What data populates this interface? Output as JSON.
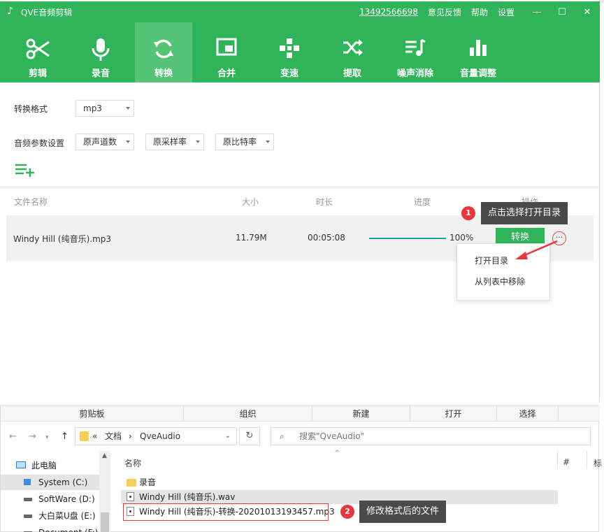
{
  "app": {
    "title": "QVE音频剪辑",
    "phone": "13492566698",
    "links": [
      "意见反馈",
      "帮助",
      "设置"
    ],
    "window_controls": [
      "—",
      "☐",
      "✕"
    ]
  },
  "toolbar": [
    {
      "label": "剪辑",
      "icon": "scissors-icon"
    },
    {
      "label": "录音",
      "icon": "microphone-icon"
    },
    {
      "label": "转换",
      "icon": "convert-icon",
      "active": true
    },
    {
      "label": "合并",
      "icon": "merge-icon"
    },
    {
      "label": "变速",
      "icon": "speed-icon"
    },
    {
      "label": "提取",
      "icon": "extract-icon"
    },
    {
      "label": "噪声消除",
      "icon": "noise-icon"
    },
    {
      "label": "音量调整",
      "icon": "volume-icon"
    }
  ],
  "settings": {
    "format_label": "转换格式",
    "format_value": "mp3",
    "params_label": "音频参数设置",
    "channels": "原声道数",
    "samplerate": "原采样率",
    "bitrate": "原比特率"
  },
  "table": {
    "headers": [
      "文件名称",
      "大小",
      "时长",
      "进度",
      "操作"
    ],
    "row": {
      "name": "Windy Hill (纯音乐).mp3",
      "size": "11.79M",
      "duration": "00:05:08",
      "progress_text": "100%",
      "progress_fraction": 1.0,
      "action": "转换",
      "more": "···"
    }
  },
  "context_menu": [
    "打开目录",
    "从列表中移除"
  ],
  "callouts": [
    {
      "num": "1",
      "text": "点击选择打开目录"
    },
    {
      "num": "2",
      "text": "修改格式后的文件"
    }
  ],
  "explorer": {
    "ribbon": [
      "剪贴板",
      "组织",
      "新建",
      "打开",
      "选择"
    ],
    "path": [
      "«",
      "文档",
      "›",
      "QveAudio"
    ],
    "search_placeholder": "搜索\"QveAudio\"",
    "nav_tree": [
      {
        "label": "此电脑",
        "icon": "computer-icon"
      },
      {
        "label": "System (C:)",
        "icon": "windows-drive-icon",
        "selected": true
      },
      {
        "label": "SoftWare (D:)",
        "icon": "drive-icon"
      },
      {
        "label": "大白菜U盘 (E:)",
        "icon": "drive-icon"
      },
      {
        "label": "Document (F:)",
        "icon": "drive-icon"
      }
    ],
    "columns": [
      "名称",
      "#",
      "标"
    ],
    "files": [
      {
        "name": "录音",
        "type": "folder"
      },
      {
        "name": "Windy Hill (纯音乐).wav",
        "type": "audio"
      },
      {
        "name": "Windy Hill (纯音乐)-转换-20201013193457.mp3",
        "type": "audio"
      }
    ]
  },
  "colors": {
    "brand": "#2fb45a",
    "brand_active": "#55c477",
    "progress": "#1aa39a",
    "accent_red": "#e8373c"
  }
}
